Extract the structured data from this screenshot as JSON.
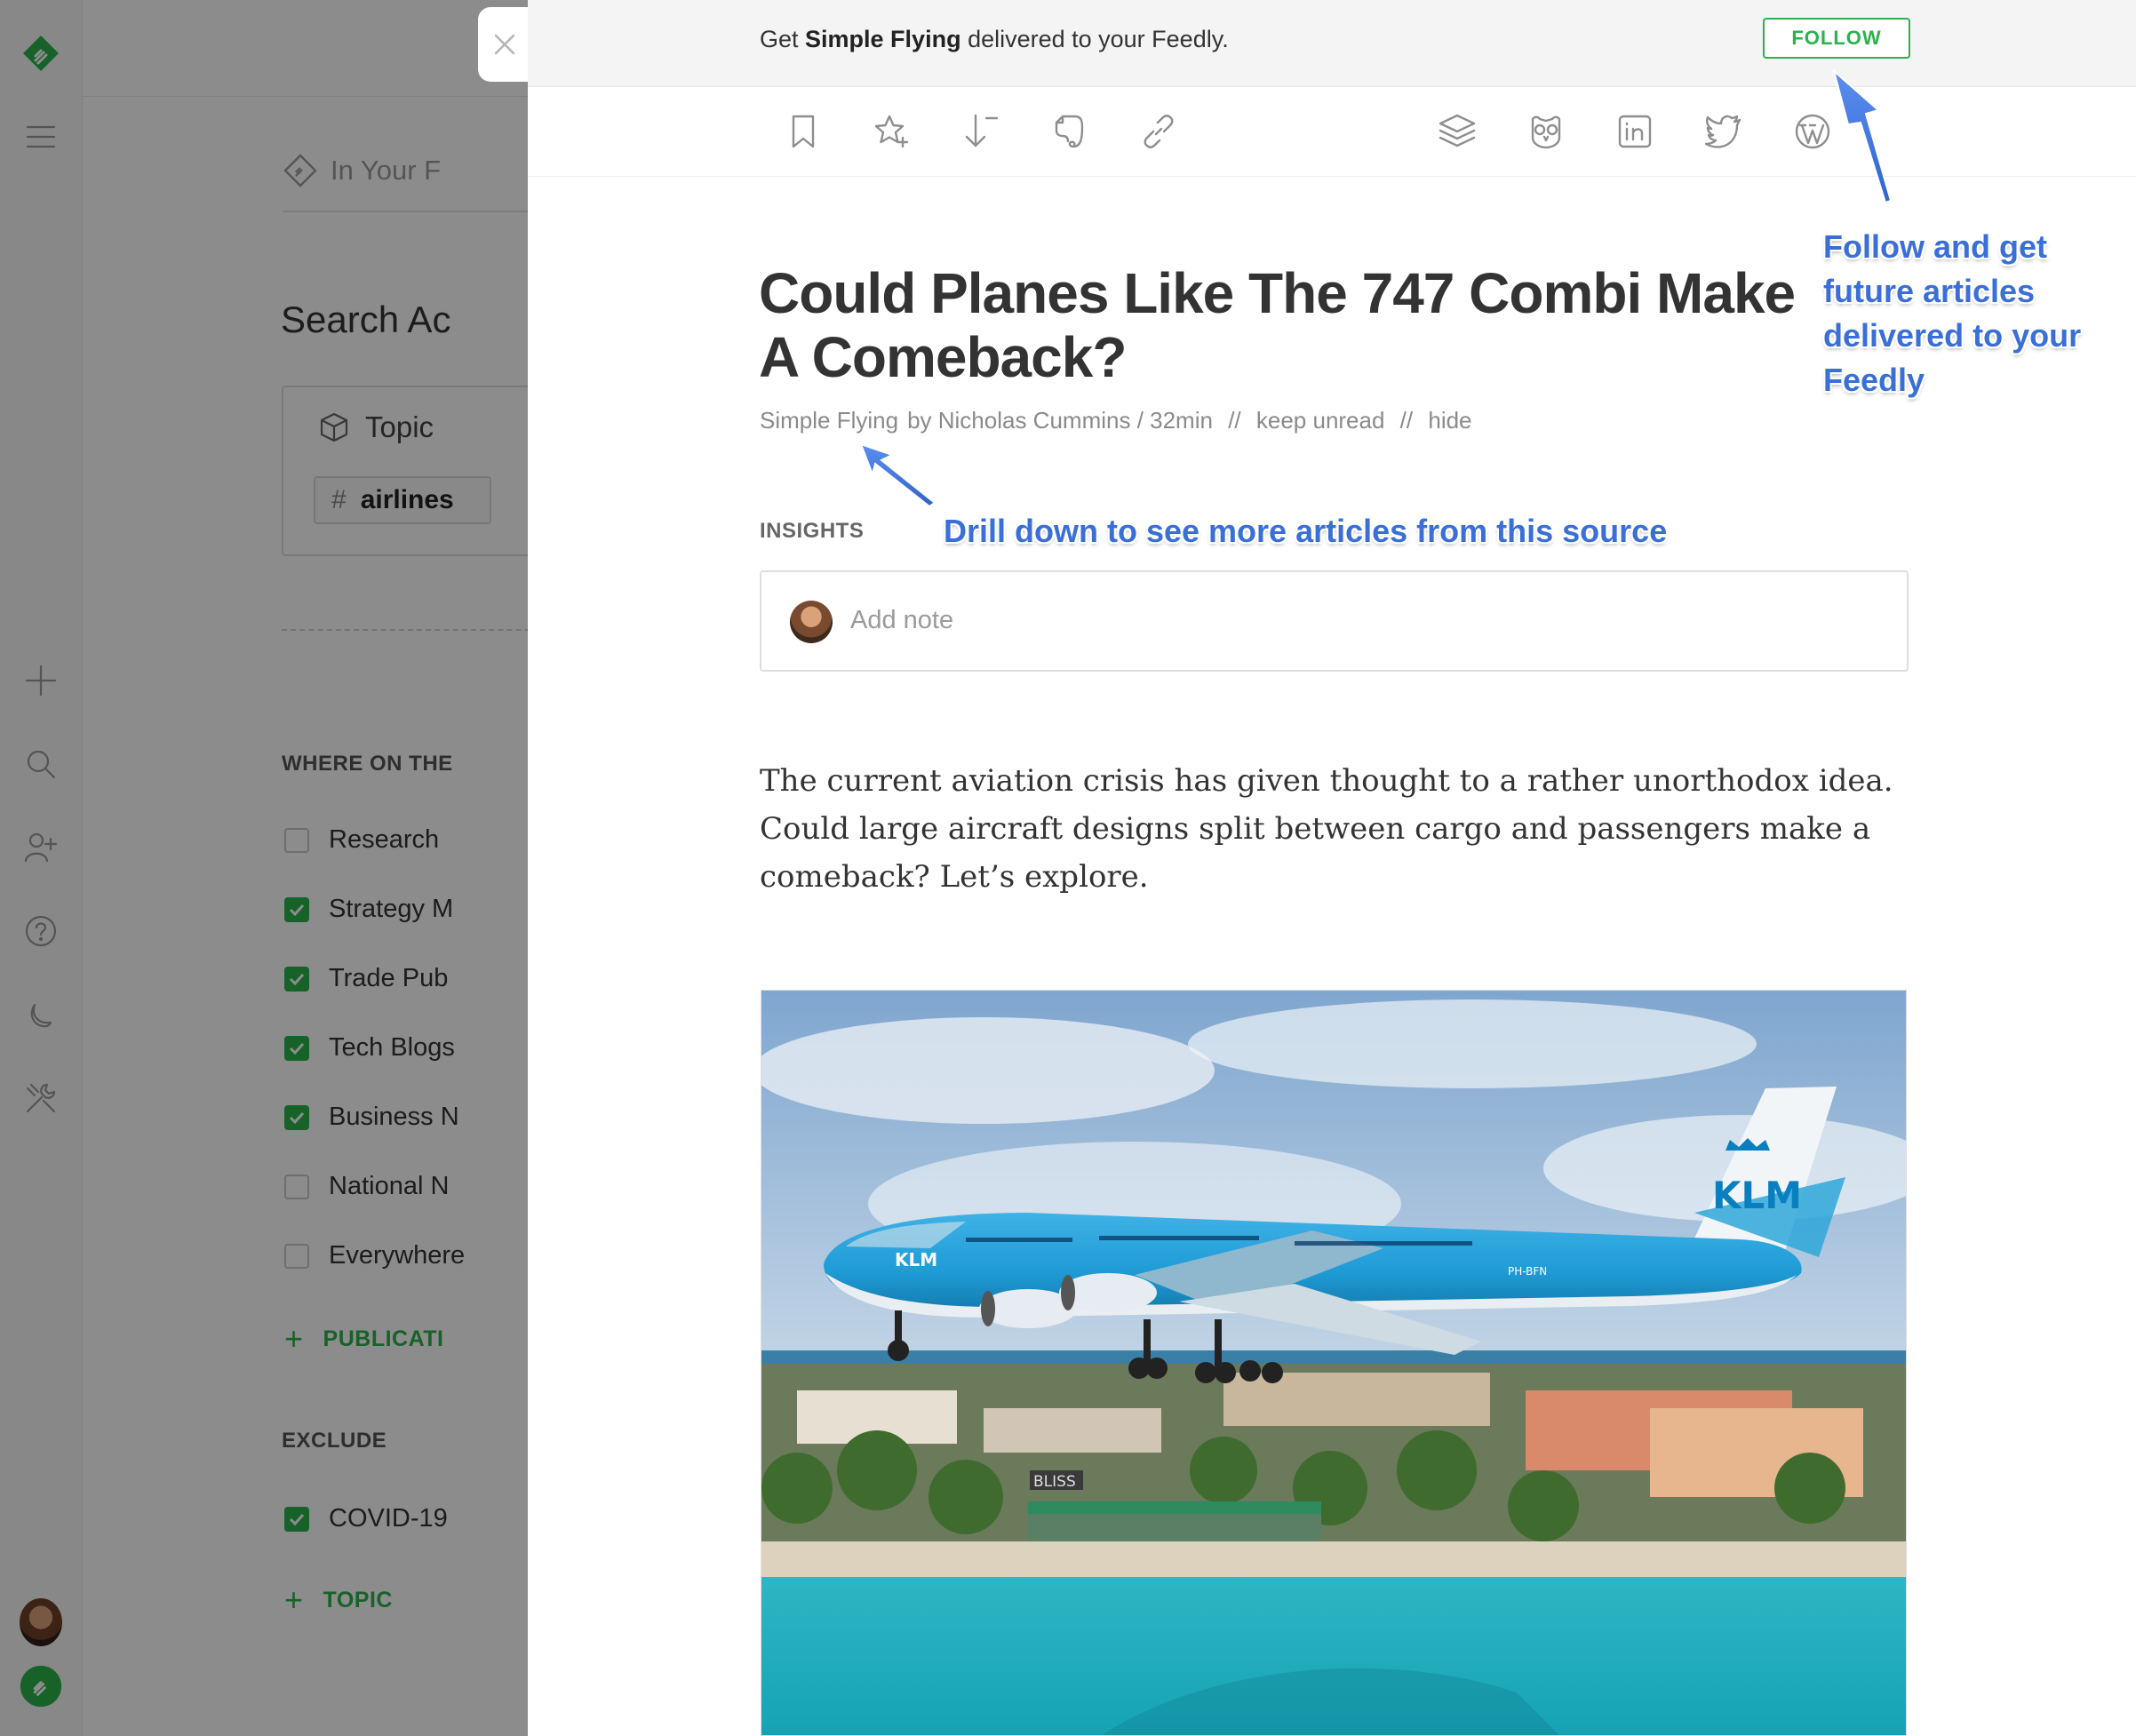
{
  "background": {
    "breadcrumb": "In Your F",
    "search_title": "Search Ac",
    "topic_label": "Topic",
    "topic_chip": "airlines",
    "where_heading": "WHERE ON THE",
    "sources": [
      {
        "label": "Research",
        "checked": false
      },
      {
        "label": "Strategy M",
        "checked": true
      },
      {
        "label": "Trade Pub",
        "checked": true
      },
      {
        "label": "Tech Blogs",
        "checked": true
      },
      {
        "label": "Business N",
        "checked": true
      },
      {
        "label": "National N",
        "checked": false
      },
      {
        "label": "Everywhere",
        "checked": false
      }
    ],
    "add_publication": "PUBLICATI",
    "exclude_heading": "EXCLUDE",
    "exclude_items": [
      {
        "label": "COVID-19",
        "checked": true
      }
    ],
    "add_topic": "TOPIC"
  },
  "rail": {
    "icons": [
      "feedly-logo-icon",
      "menu-icon",
      "plus-icon",
      "search-icon",
      "add-user-icon",
      "help-icon",
      "moon-icon",
      "tools-icon",
      "avatar",
      "feedly-badge-icon"
    ]
  },
  "banner": {
    "prefix": "Get ",
    "source": "Simple Flying",
    "suffix": " delivered to your Feedly.",
    "follow_label": "FOLLOW"
  },
  "article": {
    "title": "Could Planes Like The 747 Combi Make A Comeback?",
    "source": "Simple Flying",
    "byline": "by Nicholas Cummins / 32min",
    "sep1": "//",
    "keep_unread": "keep unread",
    "sep2": "//",
    "hide": "hide",
    "insights_label": "INSIGHTS",
    "note_placeholder": "Add note",
    "lede": "The current aviation crisis has given thought to a rather unorthodox idea. Could large aircraft designs split between cargo and passengers make a comeback? Let’s explore.",
    "image_alt": "KLM Boeing 747 landing over a beach",
    "image_labels": {
      "tail": "KLM",
      "fuselage": "KLM",
      "registration": "PH-BFN",
      "sign": "BLISS"
    }
  },
  "annotations": {
    "follow_note": [
      "Follow and get",
      "future articles",
      "delivered to your",
      "Feedly"
    ],
    "drill_note": "Drill down to see more articles from this source",
    "color": "#3a6fd8"
  },
  "colors": {
    "accent": "#2bb24c",
    "annotation": "#3a6fd8"
  }
}
